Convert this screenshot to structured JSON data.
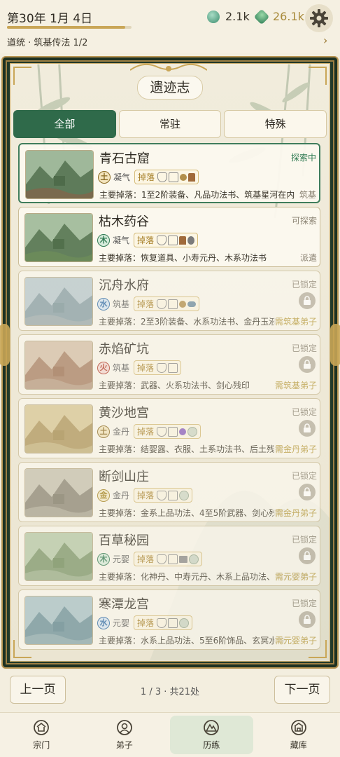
{
  "header": {
    "date": "第30年 1月 4日",
    "date_progress": 0.95,
    "res1_value": "2.1k",
    "res1_icon": "spirit-stone-icon",
    "res2_value": "26.1k",
    "res2_icon": "jade-icon",
    "settings_icon": "gear-icon",
    "breadcrumb": "道统 · 筑基传法  1/2",
    "breadcrumb_arrow": "›"
  },
  "panel": {
    "title": "遗迹志",
    "tabs": [
      {
        "label": "全部",
        "active": true
      },
      {
        "label": "常驻",
        "active": false
      },
      {
        "label": "特殊",
        "active": false
      }
    ]
  },
  "ruins": [
    {
      "name": "青石古窟",
      "element": "土",
      "element_type": "earth",
      "realm": "凝气",
      "drops_label": "掉落",
      "drop_icons": [
        "shield",
        "book",
        "orb",
        "ink"
      ],
      "main_drops": "主要掉落：1至2阶装备、凡品功法书、筑基星河在内",
      "side_text": "筑基",
      "status": "探索中",
      "state": "exploring"
    },
    {
      "name": "枯木药谷",
      "element": "木",
      "element_type": "wood",
      "realm": "凝气",
      "drops_label": "掉落",
      "drop_icons": [
        "shield",
        "book",
        "ink",
        "gourd"
      ],
      "main_drops": "主要掉落：恢复道具、小寿元丹、木系功法书",
      "side_text": "派遣",
      "status": "可探索",
      "state": "available"
    },
    {
      "name": "沉舟水府",
      "element": "水",
      "element_type": "water",
      "realm": "筑基",
      "drops_label": "掉落",
      "drop_icons": [
        "shield",
        "book",
        "orb",
        "pill"
      ],
      "main_drops": "主要掉落：2至3阶装备、水系功法书、金丹玉液",
      "side_text": "需筑基弟子",
      "status": "已锁定",
      "state": "locked"
    },
    {
      "name": "赤焰矿坑",
      "element": "火",
      "element_type": "fire",
      "realm": "筑基",
      "drops_label": "掉落",
      "drop_icons": [
        "shield",
        "book"
      ],
      "main_drops": "主要掉落：武器、火系功法书、剑心残印",
      "side_text": "需筑基弟子",
      "status": "已锁定",
      "state": "locked"
    },
    {
      "name": "黄沙地宫",
      "element": "土",
      "element_type": "earth",
      "realm": "金丹",
      "drops_label": "掉落",
      "drop_icons": [
        "shield",
        "book",
        "purple",
        "jade"
      ],
      "main_drops": "主要掉落：结婴露、衣服、土系功法书、后土残印",
      "side_text": "需金丹弟子",
      "status": "已锁定",
      "state": "locked"
    },
    {
      "name": "断剑山庄",
      "element": "金",
      "element_type": "metal",
      "realm": "金丹",
      "drops_label": "掉落",
      "drop_icons": [
        "shield",
        "book",
        "jade"
      ],
      "main_drops": "主要掉落：金系上品功法、4至5阶武器、剑心残印",
      "side_text": "需金丹弟子",
      "status": "已锁定",
      "state": "locked"
    },
    {
      "name": "百草秘园",
      "element": "木",
      "element_type": "wood",
      "realm": "元婴",
      "drops_label": "掉落",
      "drop_icons": [
        "shield",
        "book",
        "scroll",
        "jade"
      ],
      "main_drops": "主要掉落：化神丹、中寿元丹、木系上品功法、万木灵种",
      "side_text": "需元婴弟子",
      "status": "已锁定",
      "state": "locked"
    },
    {
      "name": "寒潭龙宫",
      "element": "水",
      "element_type": "water",
      "realm": "元婴",
      "drops_label": "掉落",
      "drop_icons": [
        "shield",
        "book",
        "jade"
      ],
      "main_drops": "主要掉落：水系上品功法、5至6阶饰品、玄冥水珠",
      "side_text": "需元婴弟子",
      "status": "已锁定",
      "state": "locked"
    }
  ],
  "pagination": {
    "prev_label": "上一页",
    "next_label": "下一页",
    "info": "1 / 3 · 共21处"
  },
  "nav": [
    {
      "label": "宗门",
      "icon": "sect-icon",
      "active": false
    },
    {
      "label": "弟子",
      "icon": "disciple-icon",
      "active": false
    },
    {
      "label": "历练",
      "icon": "mountain-icon",
      "active": true
    },
    {
      "label": "藏库",
      "icon": "storehouse-icon",
      "active": false
    }
  ],
  "colors": {
    "accent_green": "#2f6a4a",
    "gold": "#c9a657",
    "frame_dark": "#233a2a",
    "background": "#f3eedf"
  }
}
